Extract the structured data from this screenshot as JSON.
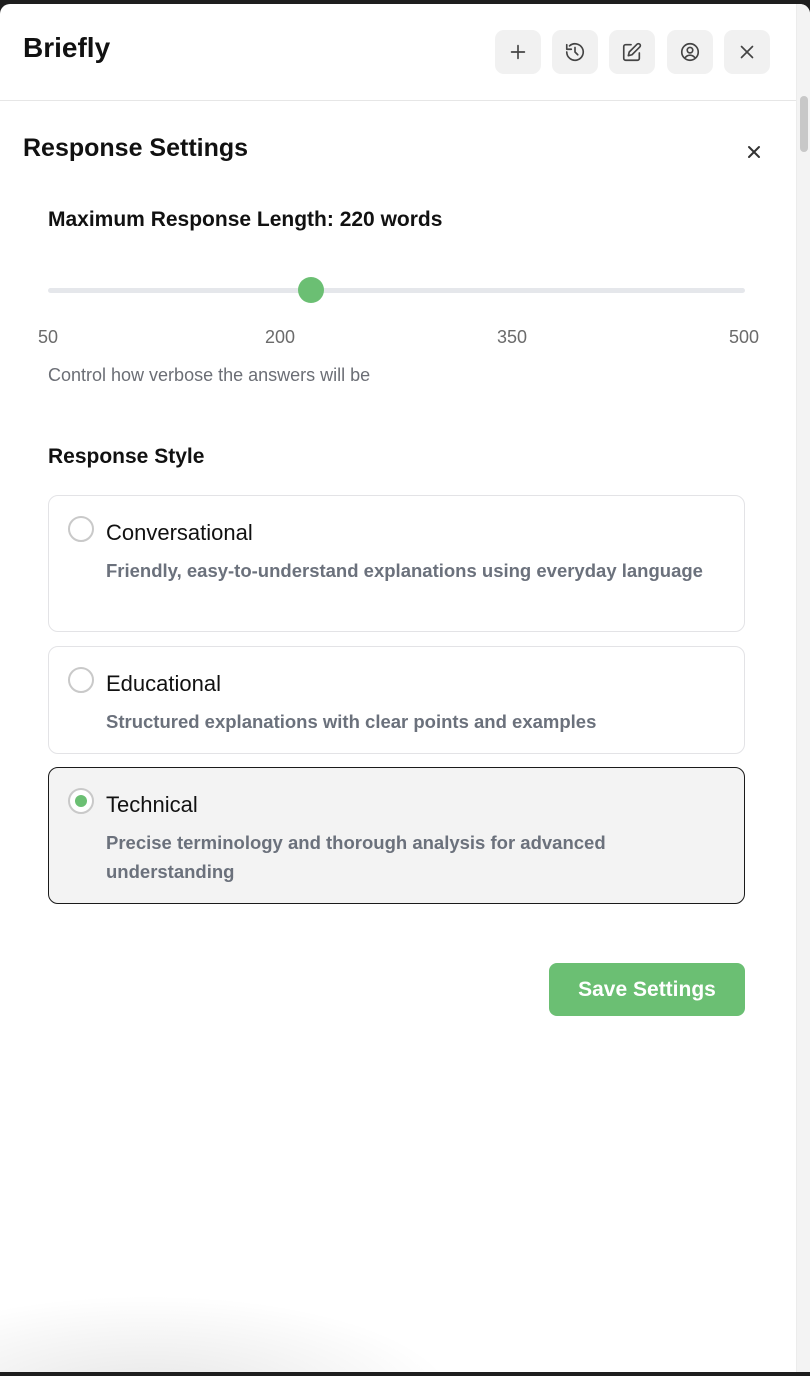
{
  "app": {
    "title": "Briefly"
  },
  "header": {
    "buttons": [
      {
        "name": "new-button",
        "icon": "plus-icon"
      },
      {
        "name": "history-button",
        "icon": "history-icon"
      },
      {
        "name": "edit-button",
        "icon": "edit-icon"
      },
      {
        "name": "account-button",
        "icon": "user-circle-icon"
      },
      {
        "name": "close-window-button",
        "icon": "close-icon"
      }
    ]
  },
  "settings": {
    "title": "Response Settings",
    "length": {
      "label": "Maximum Response Length: 220 words",
      "value": 220,
      "min": 50,
      "max": 500,
      "ticks": [
        "50",
        "200",
        "350",
        "500"
      ],
      "helper": "Control how verbose the answers will be"
    },
    "style": {
      "label": "Response Style",
      "options": [
        {
          "title": "Conversational",
          "description": "Friendly, easy-to-understand explanations using everyday language",
          "selected": false
        },
        {
          "title": "Educational",
          "description": "Structured explanations with clear points and examples",
          "selected": false
        },
        {
          "title": "Technical",
          "description": "Precise terminology and thorough analysis for advanced understanding",
          "selected": true
        }
      ]
    },
    "save_label": "Save Settings"
  },
  "colors": {
    "accent": "#6bbf73",
    "selected_border": "#1a1a1a"
  }
}
